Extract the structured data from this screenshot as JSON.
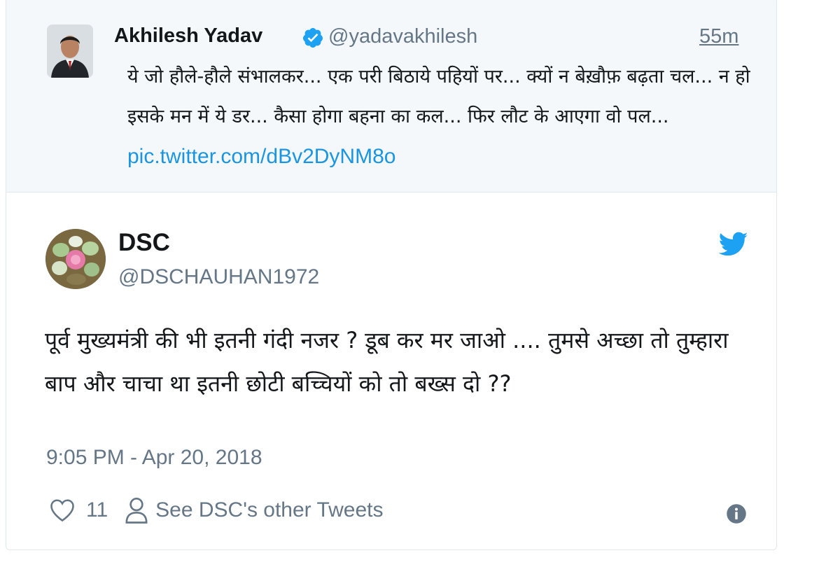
{
  "parent_tweet": {
    "display_name": "Akhilesh Yadav",
    "handle": "@yadavakhilesh",
    "time": "55m",
    "text": "ये जो हौले-हौले संभालकर... एक परी बिठाये पहियों पर... क्यों न बेख़ौफ़ बढ़ता चल... न हो इसके मन में ये डर... कैसा होगा बहना का कल... फिर लौट के आएगा वो पल... ",
    "link": "pic.twitter.com/dBv2DyNM8o",
    "verified": true
  },
  "tweet": {
    "display_name": "DSC",
    "handle": "@DSCHAUHAN1972",
    "text": "पूर्व मुख्यमंत्री की भी इतनी गंदी नजर ? डूब कर मर जाओ .... तुमसे अच्छा तो तुम्हारा बाप और चाचा था  इतनी छोटी बच्चियों को तो बख्स दो ??",
    "timestamp": "9:05 PM - Apr 20, 2018",
    "like_count": "11",
    "other_tweets_label": "See DSC's other Tweets"
  },
  "icons": {
    "verified": "verified-badge-icon",
    "twitter": "twitter-bird-icon",
    "like": "heart-icon",
    "profile": "person-icon",
    "info": "info-icon"
  },
  "colors": {
    "brand_blue": "#1da1f2",
    "link_blue": "#1b95e0",
    "secondary_text": "#657786",
    "parent_background": "#f5f8fa",
    "border": "#e1e8ed"
  }
}
